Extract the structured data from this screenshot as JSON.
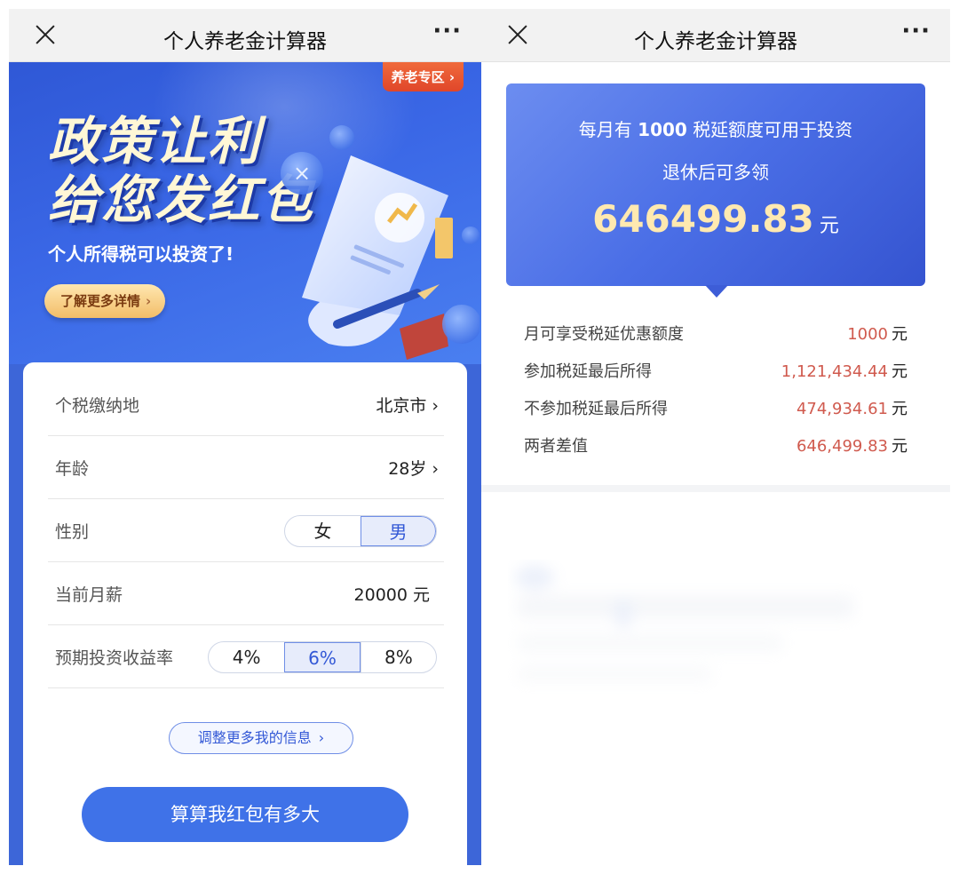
{
  "left": {
    "nav": {
      "title": "个人养老金计算器",
      "more": "···"
    },
    "banner": {
      "zone_tag": "养老专区",
      "headline_1": "政策让利",
      "headline_2": "给您发红包",
      "subline": "个人所得税可以投资了!",
      "more_button": "了解更多详情"
    },
    "form": {
      "rows": [
        {
          "label": "个税缴纳地",
          "value": "北京市"
        },
        {
          "label": "年龄",
          "value": "28岁"
        },
        {
          "label": "性别"
        },
        {
          "label": "当前月薪",
          "value": "20000 元"
        },
        {
          "label": "预期投资收益率"
        }
      ],
      "gender_options": [
        "女",
        "男"
      ],
      "gender_selected": "男",
      "rate_options": [
        "4%",
        "6%",
        "8%"
      ],
      "rate_selected": "6%",
      "adjust_button": "调整更多我的信息",
      "calc_button": "算算我红包有多大"
    }
  },
  "right": {
    "nav": {
      "title": "个人养老金计算器",
      "more": "···"
    },
    "result": {
      "line1_prefix": "每月有",
      "line1_amount": "1000",
      "line1_suffix": "税延额度可用于投资",
      "line2": "退休后可多领",
      "amount": "646499.83",
      "amount_unit": "元"
    },
    "details": [
      {
        "label": "月可享受税延优惠额度",
        "value": "1000",
        "unit": "元"
      },
      {
        "label": "参加税延最后所得",
        "value": "1,121,434.44",
        "unit": "元"
      },
      {
        "label": "不参加税延最后所得",
        "value": "474,934.61",
        "unit": "元"
      },
      {
        "label": "两者差值",
        "value": "646,499.83",
        "unit": "元"
      }
    ]
  }
}
